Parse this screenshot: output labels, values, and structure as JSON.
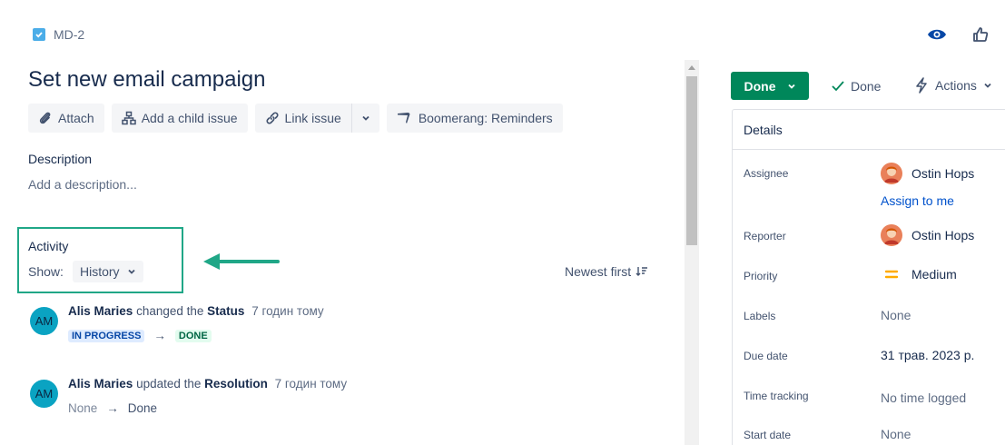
{
  "issue": {
    "key": "MD-2",
    "title": "Set new email campaign"
  },
  "toolbar": {
    "attach": "Attach",
    "add_child": "Add a child issue",
    "link_issue": "Link issue",
    "boomerang": "Boomerang: Reminders"
  },
  "description": {
    "label": "Description",
    "placeholder": "Add a description..."
  },
  "activity": {
    "label": "Activity",
    "show_label": "Show:",
    "show_value": "History",
    "sort_label": "Newest first",
    "entries": [
      {
        "avatar": "AM",
        "user": "Alis Maries",
        "action": "changed the",
        "field": "Status",
        "time": "7 годин тому",
        "from": "IN PROGRESS",
        "to": "DONE"
      },
      {
        "avatar": "AM",
        "user": "Alis Maries",
        "action": "updated the",
        "field": "Resolution",
        "time": "7 годин тому",
        "from": "None",
        "to": "Done"
      }
    ]
  },
  "status": {
    "button": "Done",
    "resolution": "Done",
    "actions": "Actions"
  },
  "details": {
    "header": "Details",
    "assignee_label": "Assignee",
    "assignee": "Ostin Hops",
    "assign_to_me": "Assign to me",
    "reporter_label": "Reporter",
    "reporter": "Ostin Hops",
    "priority_label": "Priority",
    "priority": "Medium",
    "labels_label": "Labels",
    "labels": "None",
    "due_label": "Due date",
    "due": "31 трав. 2023 р.",
    "time_label": "Time tracking",
    "time": "No time logged",
    "start_label": "Start date",
    "start": "None"
  },
  "colors": {
    "done_green": "#00875a",
    "highlight_box": "#20a787",
    "link_blue": "#0052cc"
  }
}
